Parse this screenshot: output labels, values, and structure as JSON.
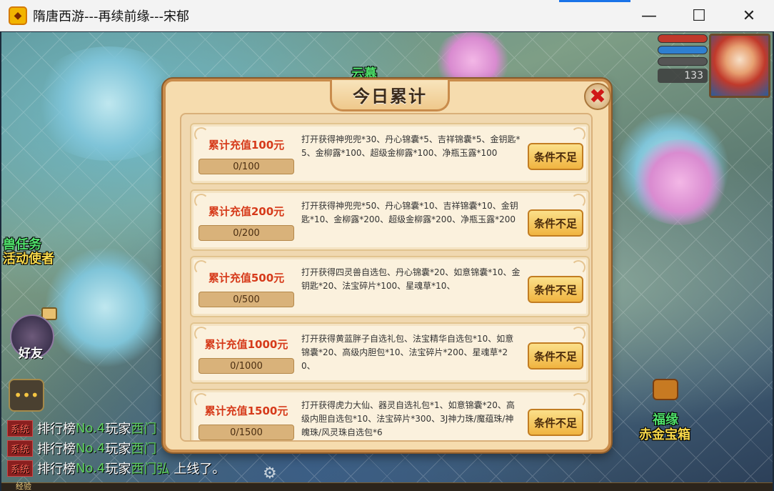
{
  "window": {
    "title": "隋唐西游---再续前缘---宋郁",
    "minimize": "—",
    "maximize": "☐",
    "close": "✕"
  },
  "hud": {
    "level": "133",
    "friend_label": "好友"
  },
  "scene_labels": {
    "npc_top": "云慕",
    "quest_line1": "兽任务",
    "quest_line2": "活动使者",
    "chest_line1": "福缘",
    "chest_line2": "赤金宝箱"
  },
  "chat": [
    {
      "tag": "系统",
      "t1": "排行榜",
      "rank": "No.4",
      "t2": "玩家",
      "name": "西门",
      "t3": ""
    },
    {
      "tag": "系统",
      "t1": "排行榜",
      "rank": "No.4",
      "t2": "玩家",
      "name": "西门",
      "t3": ""
    },
    {
      "tag": "系统",
      "t1": "排行榜",
      "rank": "No.4",
      "t2": "玩家",
      "name": "西门弘",
      "t3": "上线了。"
    }
  ],
  "xp_label": "经验",
  "modal": {
    "title": "今日累计",
    "close": "✖",
    "rewards": [
      {
        "title": "累计充值100元",
        "progress": "0/100",
        "desc": "打开获得神兜兜*30、丹心锦囊*5、吉祥锦囊*5、金钥匙*5、金柳露*100、超级金柳露*100、净瓶玉露*100",
        "button": "条件不足"
      },
      {
        "title": "累计充值200元",
        "progress": "0/200",
        "desc": "打开获得神兜兜*50、丹心锦囊*10、吉祥锦囊*10、金钥匙*10、金柳露*200、超级金柳露*200、净瓶玉露*200",
        "button": "条件不足"
      },
      {
        "title": "累计充值500元",
        "progress": "0/500",
        "desc": "打开获得四灵兽自选包、丹心锦囊*20、如意锦囊*10、金钥匙*20、法宝碎片*100、星魂草*10、",
        "button": "条件不足"
      },
      {
        "title": "累计充值1000元",
        "progress": "0/1000",
        "desc": "打开获得黄蓝胖子自选礼包、法宝精华自选包*10、如意锦囊*20、高级内胆包*10、法宝碎片*200、星魂草*20、",
        "button": "条件不足"
      },
      {
        "title": "累计充值1500元",
        "progress": "0/1500",
        "desc": "打开获得虎力大仙、器灵自选礼包*1、如意锦囊*20、高级内胆自选包*10、法宝碎片*300、3J神力珠/魔蕴珠/神魄珠/风灵珠自选包*6",
        "button": "条件不足"
      }
    ]
  }
}
